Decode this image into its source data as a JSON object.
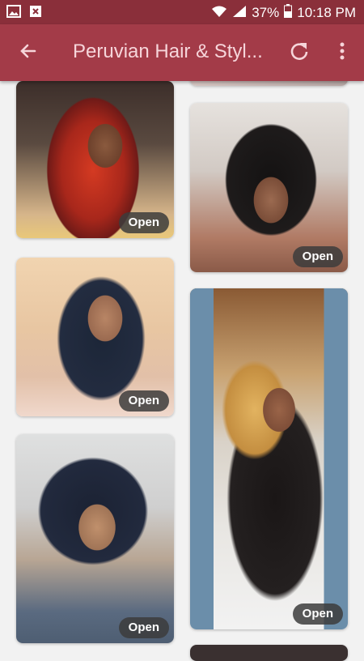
{
  "status_bar": {
    "battery": "37%",
    "time": "10:18 PM",
    "icons": [
      "image-icon",
      "close-notification-icon",
      "wifi-icon",
      "signal-icon",
      "battery-icon"
    ]
  },
  "app_bar": {
    "title": "Peruvian Hair & Styl...",
    "back_icon": "arrow-left-icon",
    "refresh_icon": "refresh-icon",
    "menu_icon": "more-vert-icon"
  },
  "cards": [
    {
      "open_label": "Open"
    },
    {
      "open_label": "Open"
    },
    {
      "open_label": "Open"
    },
    {
      "open_label": "Open"
    },
    {
      "open_label": "Open"
    }
  ],
  "colors": {
    "status_bar": "#8a2f3a",
    "app_bar": "#a33b48",
    "title_text": "#f6d5da",
    "background": "#f2f2f2"
  }
}
